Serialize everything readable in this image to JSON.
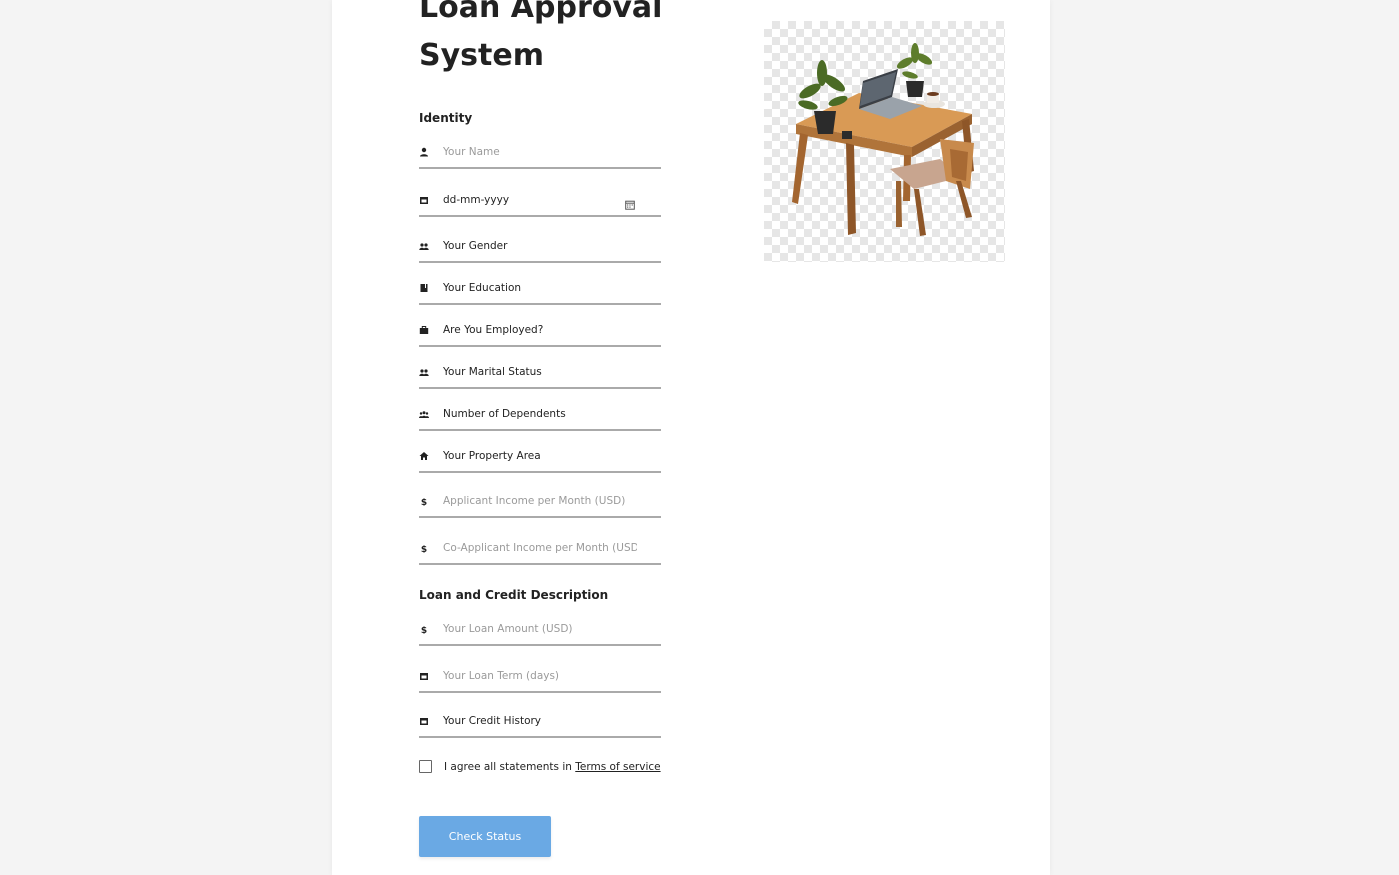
{
  "form": {
    "title": "Loan Approval System",
    "sections": {
      "identity": "Identity",
      "loan": "Loan and Credit Description"
    },
    "fields": [
      {
        "name": "name-field",
        "icon": "person-icon",
        "text": "Your Name",
        "kind": "placeholder"
      },
      {
        "name": "dob-field",
        "icon": "calendar-icon",
        "text": "dd-mm-yyyy",
        "kind": "value"
      },
      {
        "name": "gender-select",
        "icon": "people-icon",
        "text": "Your Gender",
        "kind": "value"
      },
      {
        "name": "education-select",
        "icon": "book-icon",
        "text": "Your Education",
        "kind": "value"
      },
      {
        "name": "employed-select",
        "icon": "briefcase-icon",
        "text": "Are You Employed?",
        "kind": "value"
      },
      {
        "name": "marital-status-select",
        "icon": "people-icon",
        "text": "Your Marital Status",
        "kind": "value"
      },
      {
        "name": "dependents-select",
        "icon": "group-icon",
        "text": "Number of Dependents",
        "kind": "value"
      },
      {
        "name": "property-area-select",
        "icon": "home-icon",
        "text": "Your Property Area",
        "kind": "value"
      },
      {
        "name": "applicant-income-field",
        "icon": "dollar-icon",
        "text": "Applicant Income per Month (USD)",
        "kind": "placeholder"
      },
      {
        "name": "coapplicant-income-field",
        "icon": "dollar-icon",
        "text": "Co-Applicant Income per Month (USD)",
        "kind": "placeholder"
      },
      {
        "name": "loan-amount-field",
        "icon": "dollar-icon",
        "text": "Your Loan Amount (USD)",
        "kind": "placeholder"
      },
      {
        "name": "loan-term-field",
        "icon": "calendar-icon",
        "text": "Your Loan Term (days)",
        "kind": "placeholder"
      },
      {
        "name": "credit-history-select",
        "icon": "calendar-icon",
        "text": "Your Credit History",
        "kind": "value"
      }
    ],
    "agree": {
      "text": "I agree all statements in ",
      "link": "Terms of service",
      "checked": false
    },
    "submit_label": "Check Status"
  },
  "colors": {
    "button": "#6aa9e4",
    "underline": "#aaaaaa",
    "background": "#f4f4f4"
  },
  "hero_image": "desk-with-laptop-and-chair-illustration"
}
